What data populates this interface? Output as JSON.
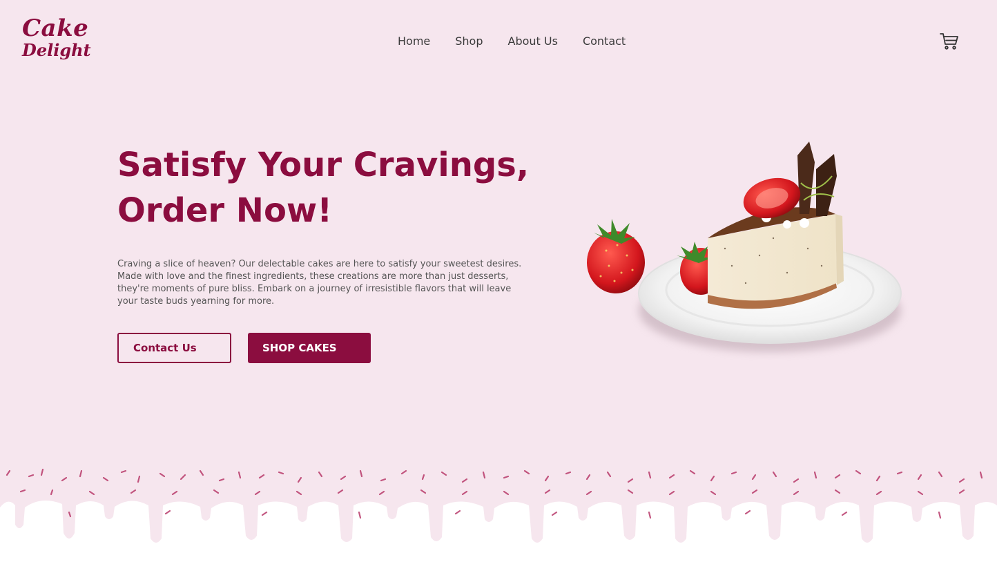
{
  "brand": {
    "line1": "Cake",
    "line2": "Delight",
    "color": "#8b0d3f"
  },
  "nav": {
    "items": [
      "Home",
      "Shop",
      "About Us",
      "Contact"
    ]
  },
  "header": {
    "cart_icon": "shopping-cart-icon"
  },
  "hero": {
    "title_line1": "Satisfy Your Cravings,",
    "title_line2": "Order Now!",
    "description": "Craving a slice of heaven? Our delectable cakes are here to satisfy your sweetest desires. Made with love and the finest ingredients, these creations are more than just desserts, they're moments of pure bliss. Embark on a journey of irresistible flavors that will leave your taste buds yearning for more.",
    "btn_contact": "Contact Us",
    "btn_shop": "SHOP CAKES"
  },
  "colors": {
    "background": "#f6e6ee",
    "accent": "#8b0d3f",
    "drip": "#ffffff"
  }
}
